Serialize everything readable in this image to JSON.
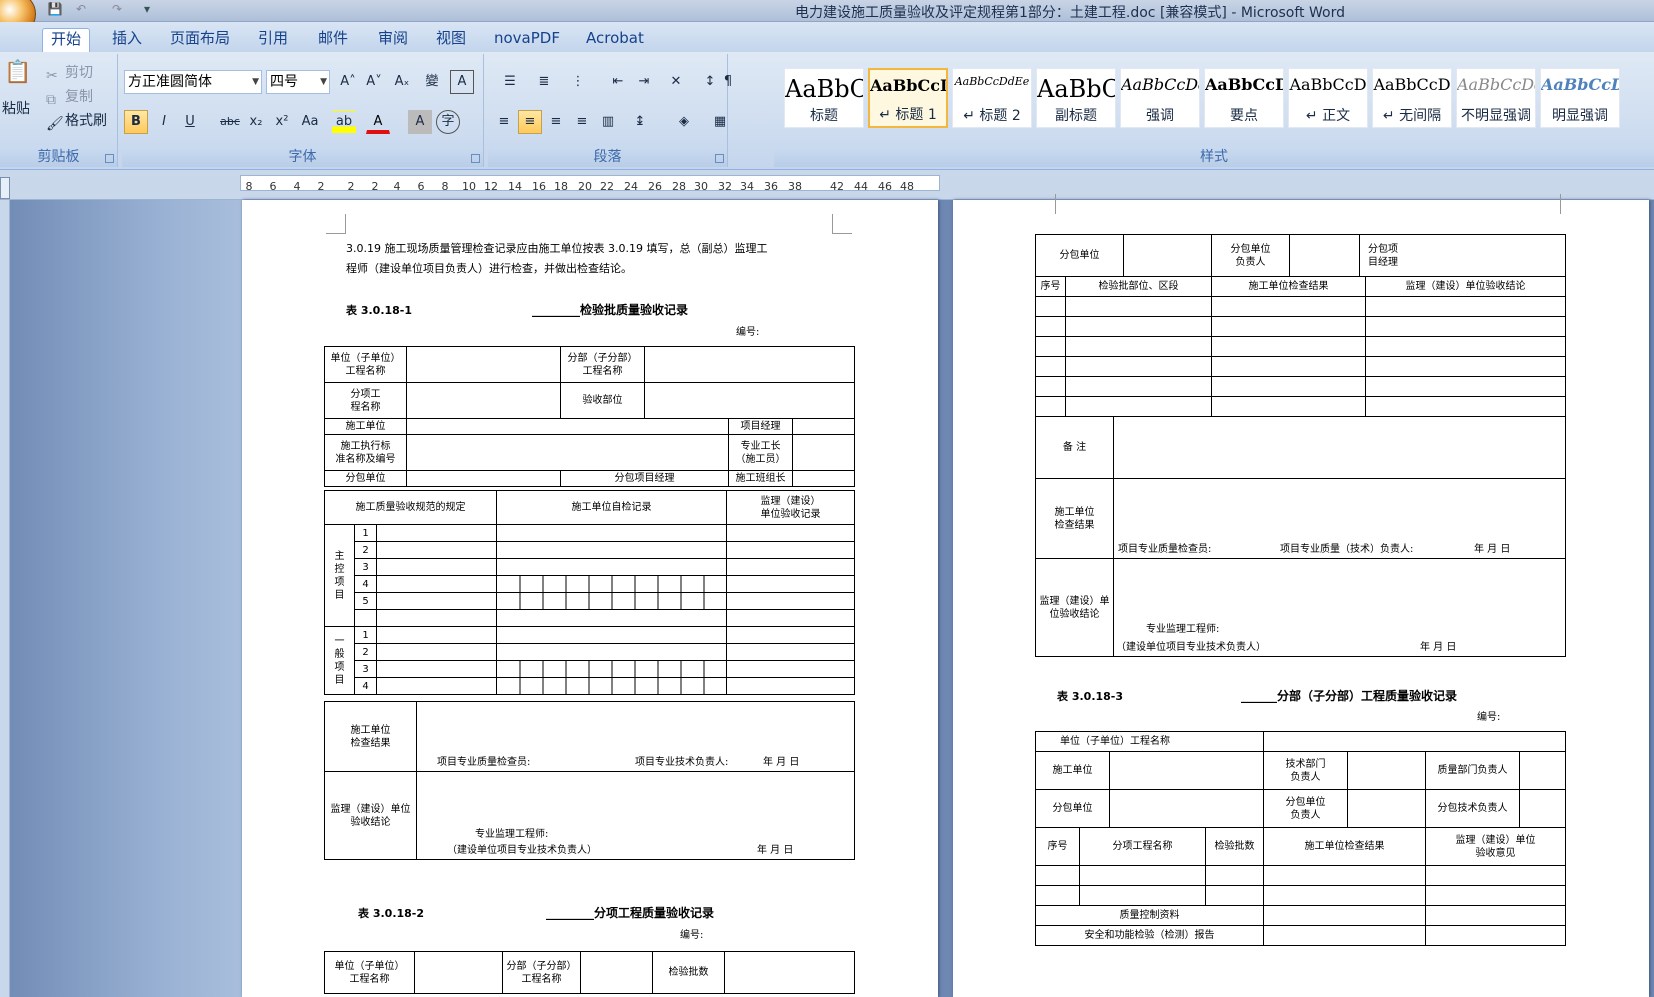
{
  "window": {
    "title": "电力建设施工质量验收及评定规程第1部分：土建工程.doc [兼容模式] - Microsoft Word"
  },
  "tabs": [
    "开始",
    "插入",
    "页面布局",
    "引用",
    "邮件",
    "审阅",
    "视图",
    "novaPDF",
    "Acrobat"
  ],
  "clipboard": {
    "paste": "粘贴",
    "cut": "剪切",
    "copy": "复制",
    "format_painter": "格式刷",
    "label": "剪贴板"
  },
  "font": {
    "name": "方正准圆简体",
    "size": "四号",
    "label": "字体",
    "bold": "B",
    "italic": "I",
    "underline": "U",
    "strike": "abc",
    "sub": "x₂",
    "sup": "x²",
    "case": "Aa",
    "grow": "A˄",
    "shrink": "A˅",
    "clear": "Aₓ",
    "phonetic": "變",
    "border_char": "A",
    "char_shade": "A",
    "enclose": "字"
  },
  "paragraph": {
    "label": "段落"
  },
  "styles": {
    "label": "样式",
    "items": [
      {
        "preview": "AaBbC",
        "name": "标题"
      },
      {
        "preview": "AaBbCcD",
        "name": "↵ 标题 1"
      },
      {
        "preview": "AaBbCcDdEe",
        "name": "↵ 标题 2"
      },
      {
        "preview": "AaBbC",
        "name": "副标题"
      },
      {
        "preview": "AaBbCcDd",
        "name": "强调"
      },
      {
        "preview": "AaBbCcD",
        "name": "要点"
      },
      {
        "preview": "AaBbCcD",
        "name": "↵ 正文"
      },
      {
        "preview": "AaBbCcD",
        "name": "↵ 无间隔"
      },
      {
        "preview": "AaBbCcDd",
        "name": "不明显强调"
      },
      {
        "preview": "AaBbCcD",
        "name": "明显强调"
      }
    ]
  },
  "ruler": {
    "ticks": [
      "8",
      "6",
      "4",
      "2",
      "2",
      "2",
      "4",
      "6",
      "8",
      "10",
      "12",
      "14",
      "16",
      "18",
      "20",
      "22",
      "24",
      "26",
      "28",
      "30",
      "32",
      "34",
      "36",
      "38",
      "42",
      "44",
      "46",
      "48"
    ]
  },
  "left_page": {
    "para1": "3.0.19    施工现场质量管理检查记录应由施工单位按表 3.0.19 填写，总（副总）监理工",
    "para2": "程师（建设单位项目负责人）进行检查，并做出检查结论。",
    "t1_no": "表 3.0.18-1",
    "t1_title": "________检验批质量验收记录",
    "number": "编号:",
    "cells": {
      "unit_name": "单位（子单位）",
      "proj_name": "工程名称",
      "div_name": "分部（子分部）",
      "item": "分项工",
      "item2": "程名称",
      "accept_part": "验收部位",
      "contractor": "施工单位",
      "pm": "项目经理",
      "exec_std": "施工执行标",
      "exec_std2": "准名称及编号",
      "foreman": "专业工长",
      "foreman2": "（施工员）",
      "sub": "分包单位",
      "sub_pm": "分包项目经理",
      "team": "施工班组长",
      "rule": "施工质量验收规范的规定",
      "self_check": "施工单位自检记录",
      "sup": "监理（建设）",
      "sup2": "单位验收记录",
      "main_ctrl": "主控项目",
      "general": "一般项目",
      "check_result": "施工单位",
      "check_result2": "检查结果",
      "qc_inspector": "项目专业质量检查员:",
      "tech_head": "项目专业技术负责人:",
      "ymd": "年    月    日",
      "sup_concl": "监理（建设）单位",
      "sup_concl2": "验收结论",
      "sup_eng": "专业监理工程师:",
      "owner_tech": "（建设单位项目专业技术负责人）"
    },
    "rows_main": [
      "1",
      "2",
      "3",
      "4",
      "5"
    ],
    "rows_gen": [
      "1",
      "2",
      "3",
      "4"
    ],
    "t2_no": "表 3.0.18-2",
    "t2_title": "________分项工程质量验收记录",
    "t2_c1": "单位（子单位）",
    "t2_c2": "工程名称",
    "t2_c3": "分部（子分部）",
    "t2_c4": "工程名称",
    "t2_c5": "检验批数"
  },
  "right_page": {
    "sub": "分包单位",
    "sub_head": "分包单位",
    "sub_head2": "负责人",
    "sub_item": "分包项",
    "sub_item2": "目经理",
    "seq": "序号",
    "lot_part": "检验批部位、区段",
    "self_result": "施工单位检查结果",
    "sup_concl": "监理（建设）单位验收结论",
    "remark": "备  注",
    "check_result": "施工单位",
    "check_result2": "检查结果",
    "qc_inspector": "项目专业质量检查员:",
    "tech_head": "项目专业质量（技术）负责人:",
    "ymd": "年    月    日",
    "sup_label": "监理（建设）单",
    "sup_label2": "位验收结论",
    "sup_eng": "专业监理工程师:",
    "owner_tech": "（建设单位项目专业技术负责人）",
    "t3_no": "表 3.0.18-3",
    "t3_title": "______分部（子分部）工程质量验收记录",
    "number": "编号:",
    "t3": {
      "unit_name": "单位（子单位）工程名称",
      "contractor": "施工单位",
      "tech_dept": "技术部门",
      "tech_dept2": "负责人",
      "quality_dept": "质量部门负责人",
      "sub": "分包单位",
      "sub_unit": "分包单位",
      "sub_unit2": "负责人",
      "sub_tech": "分包技术负责人",
      "seq": "序号",
      "item_name": "分项工程名称",
      "lots": "检验批数",
      "self_result": "施工单位检查结果",
      "sup_opinion": "监理（建设）单位",
      "sup_opinion2": "验收意见",
      "qc_data": "质量控制资料",
      "safety": "安全和功能检验（检测）报告"
    }
  }
}
